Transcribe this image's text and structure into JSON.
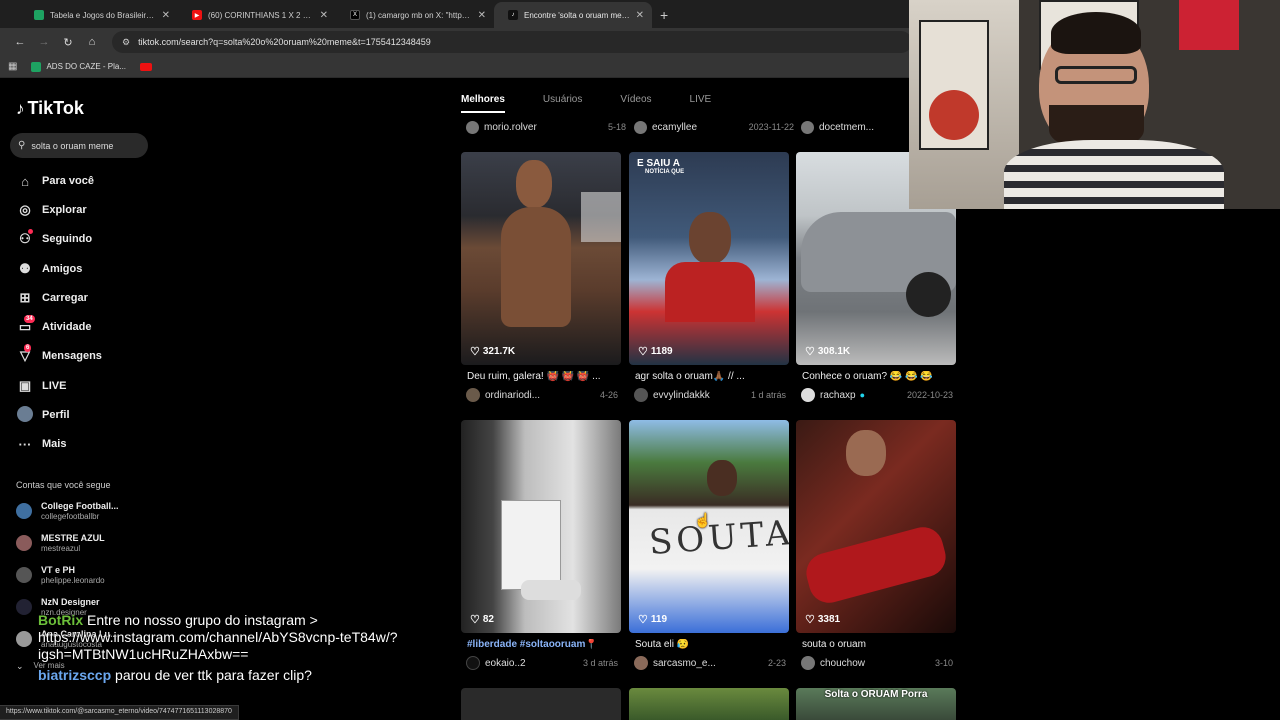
{
  "browser": {
    "tabs": [
      {
        "title": "Tabela e Jogos do Brasileirão Sé",
        "icon": "sheet-icon",
        "color": "#1ea362"
      },
      {
        "title": "(60) CORINTHIANS 1 X 2 BAHIA",
        "icon": "youtube-icon",
        "color": "#e11"
      },
      {
        "title": "(1) camargo mb on X: \"https://",
        "icon": "x-icon",
        "color": "#000"
      },
      {
        "title": "Encontre 'solta o oruam meme",
        "icon": "tiktok-icon",
        "color": "#111"
      }
    ],
    "url": "tiktok.com/search?q=solta%20o%20oruam%20meme&t=1755412348459",
    "bookmarks": [
      {
        "label": "ADS DO CAZE - Pla..."
      }
    ],
    "status_url": "https://www.tiktok.com/@sarcasmo_eterno/video/7474771651113028870"
  },
  "sidebar": {
    "logo": "TikTok",
    "search_value": "solta o oruam meme",
    "nav": [
      {
        "label": "Para você",
        "icon": "home-icon"
      },
      {
        "label": "Explorar",
        "icon": "compass-icon"
      },
      {
        "label": "Seguindo",
        "icon": "following-icon"
      },
      {
        "label": "Amigos",
        "icon": "friends-icon"
      },
      {
        "label": "Carregar",
        "icon": "upload-icon"
      },
      {
        "label": "Atividade",
        "icon": "activity-icon",
        "badge": "34"
      },
      {
        "label": "Mensagens",
        "icon": "messages-icon",
        "badge": "6"
      },
      {
        "label": "LIVE",
        "icon": "live-icon"
      },
      {
        "label": "Perfil",
        "icon": "profile-icon"
      },
      {
        "label": "Mais",
        "icon": "more-icon"
      }
    ],
    "following_title": "Contas que você segue",
    "following": [
      {
        "name": "College Football...",
        "user": "collegefootballbr"
      },
      {
        "name": "MESTRE AZUL",
        "user": "mestreazul"
      },
      {
        "name": "VT e PH",
        "user": "phelippe.leonardo"
      },
      {
        "name": "NzN Designer",
        "user": "nzn.designer"
      },
      {
        "name": "Ana Carolina Lu...",
        "user": "anaaugustocosta"
      }
    ],
    "see_more": "Ver mais"
  },
  "search_tabs": [
    "Melhores",
    "Usuários",
    "Vídeos",
    "LIVE"
  ],
  "top_row": [
    {
      "user": "morio.rolver",
      "date": "5-18"
    },
    {
      "user": "ecamyllee",
      "date": "2023-11-22"
    },
    {
      "user": "docetmem...",
      "date": ""
    }
  ],
  "videos": [
    {
      "likes": "321.7K",
      "caption": "Deu ruim, galera! 👹 👹 👹 ...",
      "user": "ordinariodi...",
      "date": "4-26"
    },
    {
      "likes": "1189",
      "caption": "agr solta o oruam🙏🏾 // ...",
      "user": "evvylindakkk",
      "date": "1 d atrás",
      "overlay": "E SAIU A",
      "overlay2": "NOTÍCIA QUE"
    },
    {
      "likes": "308.1K",
      "caption": "Conhece o oruam? 😂 😂 😂",
      "user": "rachaxp",
      "date": "2022-10-23",
      "verified": true
    },
    {
      "likes": "82",
      "caption": "#liberdade #soltaooruam📍",
      "user": "eokaio..2",
      "date": "3 d atrás"
    },
    {
      "likes": "119",
      "caption": "Souta eli 😥",
      "user": "sarcasmo_e...",
      "date": "2-23"
    },
    {
      "likes": "3381",
      "caption": "souta o oruam",
      "user": "chouchow",
      "date": "3-10"
    }
  ],
  "bottom_overlay": "Solta o ORUAM Porra",
  "chat": [
    {
      "user": "BotRix",
      "text": "Entre no nosso grupo do instagram > https://www.instagram.com/channel/AbYS8vcnp-teT84w/?igsh=MTBtNW1ucHRuZHAxbw=="
    },
    {
      "user": "biatrizsccp",
      "text": "parou de ver ttk para fazer clip?"
    }
  ]
}
